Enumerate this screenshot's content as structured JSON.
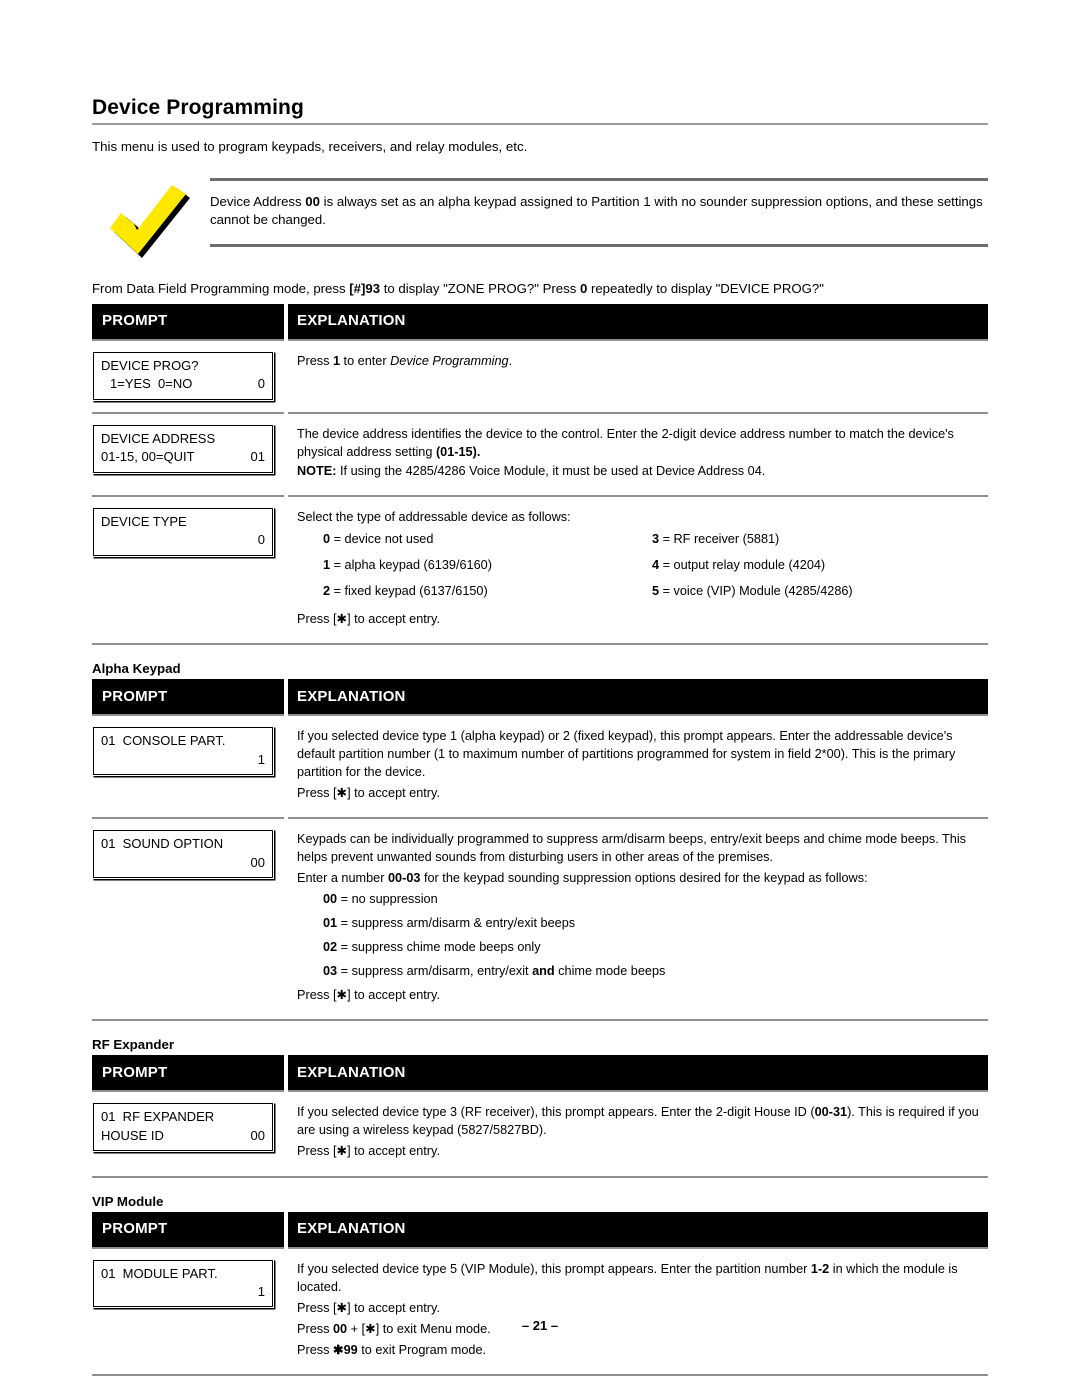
{
  "page": {
    "title": "Device Programming",
    "intro": "This menu is used to program keypads, receivers, and relay modules, etc.",
    "footer": "– 21 –"
  },
  "callout": {
    "icon": "checkmark-icon",
    "icon_colors": {
      "fill": "#FFE800",
      "shadow": "#000000"
    },
    "text_before_bold": "Device Address ",
    "bold": "00",
    "text_after_bold": " is always set as an alpha keypad assigned to Partition 1 with no sounder suppression options, and these settings cannot be changed."
  },
  "lead_line": {
    "p1": "From Data Field Programming mode, press ",
    "b1": "[#]93",
    "p2": " to display \"ZONE PROG?\" Press ",
    "b2": "0",
    "p3": " repeatedly to display \"DEVICE PROG?\""
  },
  "table_headers": {
    "prompt": "PROMPT",
    "explanation": "EXPLANATION"
  },
  "sections": [
    {
      "label": "",
      "rows": [
        {
          "lcd": {
            "lines": [
              {
                "left": "DEVICE PROG?",
                "right": ""
              },
              {
                "left": "1=YES  0=NO",
                "right": "0",
                "indent": true
              }
            ]
          },
          "explanation_id": "exp-device-prog"
        },
        {
          "lcd": {
            "lines": [
              {
                "left": "DEVICE ADDRESS",
                "right": ""
              },
              {
                "left": "01-15, 00=QUIT",
                "right": "01"
              }
            ]
          },
          "explanation_id": "exp-device-address"
        },
        {
          "lcd": {
            "lines": [
              {
                "left": "DEVICE TYPE",
                "right": ""
              },
              {
                "left": "",
                "right": "0"
              }
            ]
          },
          "explanation_id": "exp-device-type"
        }
      ]
    },
    {
      "label": "Alpha Keypad",
      "rows": [
        {
          "lcd": {
            "lines": [
              {
                "left": "01  CONSOLE PART.",
                "right": ""
              },
              {
                "left": "",
                "right": "1"
              }
            ]
          },
          "explanation_id": "exp-console-part"
        },
        {
          "lcd": {
            "lines": [
              {
                "left": "01  SOUND OPTION",
                "right": ""
              },
              {
                "left": "",
                "right": "00"
              }
            ]
          },
          "explanation_id": "exp-sound-option"
        }
      ]
    },
    {
      "label": "RF Expander",
      "rows": [
        {
          "lcd": {
            "lines": [
              {
                "left": "01  RF EXPANDER",
                "right": ""
              },
              {
                "left": "HOUSE ID",
                "right": "00"
              }
            ]
          },
          "explanation_id": "exp-rf-expander"
        }
      ]
    },
    {
      "label": "VIP Module",
      "rows": [
        {
          "lcd": {
            "lines": [
              {
                "left": "01  MODULE PART.",
                "right": ""
              },
              {
                "left": "",
                "right": "1"
              }
            ]
          },
          "explanation_id": "exp-module-part"
        }
      ]
    }
  ],
  "explanations": {
    "device_prog": {
      "p1_a": "Press ",
      "p1_b": "1",
      "p1_c": " to enter ",
      "p1_i": "Device Programming",
      "p1_d": "."
    },
    "device_address": {
      "p1_a": "The device address identifies the device to the control.  Enter the 2-digit device address number to match the device's physical address setting ",
      "p1_b": "(01-15).",
      "note_label": "NOTE:",
      "note_text": " If using the 4285/4286 Voice Module, it must be used at Device Address 04."
    },
    "device_type": {
      "intro": "Select the type of addressable device as follows:",
      "options_left": [
        {
          "num": "0",
          "text": " = device not used"
        },
        {
          "num": "1",
          "text": " = alpha keypad (6139/6160)"
        },
        {
          "num": "2",
          "text": " = fixed keypad (6137/6150)"
        }
      ],
      "options_right": [
        {
          "num": "3",
          "text": " = RF receiver (5881)"
        },
        {
          "num": "4",
          "text": " = output relay module (4204)"
        },
        {
          "num": "5",
          "text": " = voice (VIP) Module (4285/4286)"
        }
      ],
      "accept": "Press [✱] to accept entry."
    },
    "console_part": {
      "p1": "If you selected device type 1 (alpha keypad) or 2 (fixed keypad), this prompt appears.  Enter the addressable device's default partition number (1 to maximum number of partitions programmed for system in field 2*00).  This is the primary partition for the device.",
      "accept": "Press [✱] to accept entry."
    },
    "sound_option": {
      "p1": "Keypads can be individually programmed to suppress arm/disarm beeps, entry/exit beeps and chime mode beeps. This helps prevent unwanted sounds from disturbing users in other areas of the premises.",
      "p2_a": "Enter a number ",
      "p2_b": "00-03",
      "p2_c": " for the keypad sounding suppression options desired for the keypad as follows:",
      "options": [
        {
          "num": "00",
          "text": " = no suppression"
        },
        {
          "num": "01",
          "text": " = suppress arm/disarm & entry/exit beeps"
        },
        {
          "num": "02",
          "text": " = suppress chime mode beeps only"
        },
        {
          "num": "03",
          "text": " = suppress arm/disarm, entry/exit ",
          "bold_mid": "and",
          "text2": " chime mode beeps"
        }
      ],
      "accept": "Press [✱] to accept entry."
    },
    "rf_expander": {
      "p1_a": "If you selected device type 3 (RF receiver), this prompt appears.  Enter the 2-digit House ID (",
      "p1_b": "00-31",
      "p1_c": ").  This is required if you are using a wireless keypad (5827/5827BD).",
      "accept": "Press [✱] to accept entry."
    },
    "module_part": {
      "p1_a": "If you selected device type 5 (VIP Module), this prompt appears.  Enter the partition number ",
      "p1_b": "1-2",
      "p1_c": " in which the module is located.",
      "accept": "Press [✱] to accept entry.",
      "exit_menu_a": "Press ",
      "exit_menu_b": "00",
      "exit_menu_c": " + [✱] to exit Menu mode.",
      "exit_prog_a": "Press ",
      "exit_prog_b": "✱99",
      "exit_prog_c": " to exit Program mode."
    }
  }
}
